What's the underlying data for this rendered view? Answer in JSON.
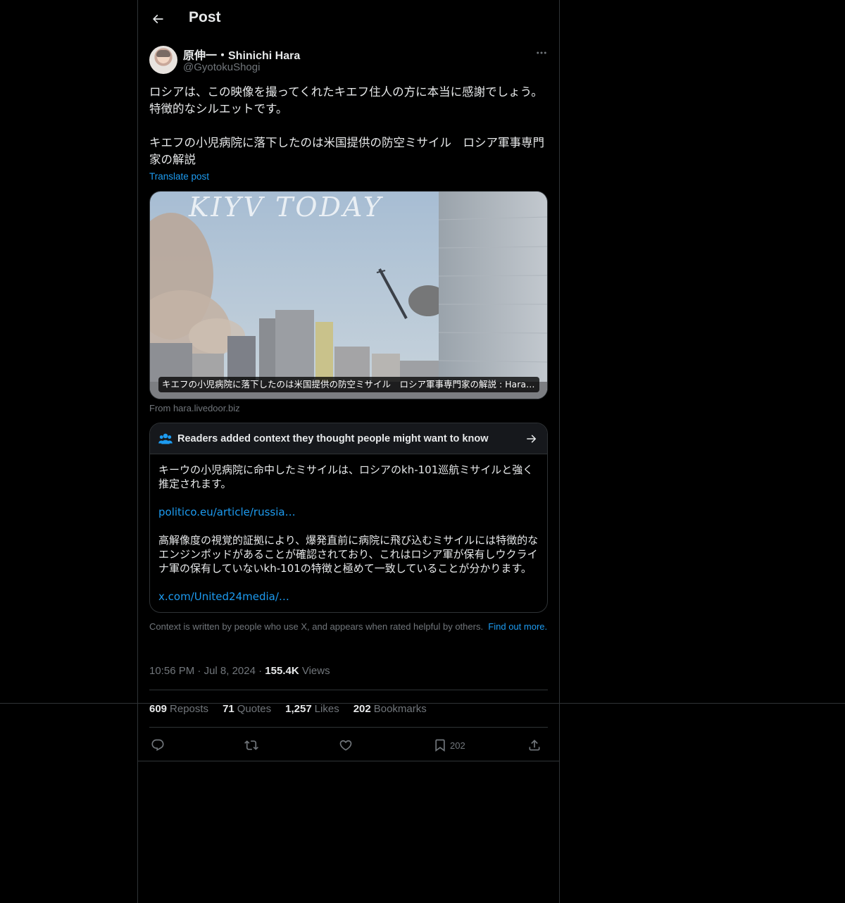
{
  "header": {
    "title": "Post",
    "back_icon": "arrow-left-icon"
  },
  "author": {
    "display_name": "原伸一・Shinichi Hara",
    "handle": "@GyotokuShogi",
    "more_icon": "more-horizontal-icon",
    "more_label": "···"
  },
  "tweet": {
    "paragraph_1": "ロシアは、この映像を撮ってくれたキエフ住人の方に本当に感謝でしょう。特徴的なシルエットです。",
    "paragraph_2": "キエフの小児病院に落下したのは米国提供の防空ミサイル　ロシア軍事専門家の解説",
    "translate_label": "Translate post"
  },
  "media_card": {
    "overlay_text": "KIYV TODAY",
    "caption": "キエフの小児病院に落下したのは米国提供の防空ミサイル　ロシア軍事専門家の解説 : Hara Shinichi",
    "source": "From hara.livedoor.biz"
  },
  "community_note": {
    "title": "Readers added context they thought people might want to know",
    "icon": "people-icon",
    "arrow_icon": "arrow-right-icon",
    "text_1": "キーウの小児病院に命中したミサイルは、ロシアのkh-101巡航ミサイルと強く推定されます。",
    "link_1": "politico.eu/article/russia…",
    "text_2": "高解像度の視覚的証拠により、爆発直前に病院に飛び込むミサイルには特徴的なエンジンポッドがあることが確認されており、これはロシア軍が保有しウクライナ軍の保有していないkh-101の特徴と極めて一致していることが分かります。",
    "link_2": "x.com/United24media/…",
    "footer_text": "Context is written by people who use X, and appears when rated helpful by others.",
    "footer_link": "Find out more."
  },
  "meta": {
    "time": "10:56 PM",
    "dot": "·",
    "date": "Jul 8, 2024",
    "views_count": "155.4K",
    "views_label": "Views"
  },
  "stats": {
    "reposts_count": "609",
    "reposts_label": "Reposts",
    "quotes_count": "71",
    "quotes_label": "Quotes",
    "likes_count": "1,257",
    "likes_label": "Likes",
    "bookmarks_count": "202",
    "bookmarks_label": "Bookmarks"
  },
  "actions": {
    "reply_icon": "reply-icon",
    "repost_icon": "repost-icon",
    "like_icon": "heart-icon",
    "bookmark_icon": "bookmark-icon",
    "bookmark_count": "202",
    "share_icon": "share-icon"
  },
  "colors": {
    "accent": "#1d9bf0",
    "background": "#000000",
    "border": "#2f3336",
    "muted": "#71767b",
    "text": "#e7e9ea"
  }
}
